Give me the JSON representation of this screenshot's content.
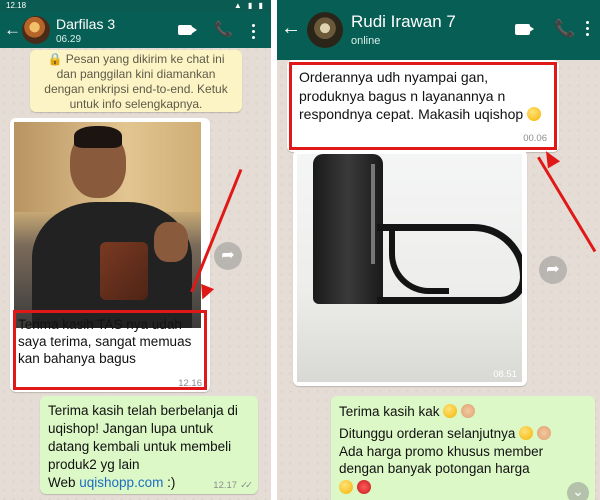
{
  "left_chat": {
    "status_time": "12.18",
    "status_icons": "▲ ▮ ▮",
    "contact_name": "Darfilas 3",
    "contact_status": "06.29",
    "system_notice": "🔒 Pesan yang dikirim ke chat ini dan panggilan kini diamankan dengan enkripsi end-to-end. Ketuk untuk info selengkapnya.",
    "incoming_text": "Terima kasih TAS nya udah saya terima, sangat memuas kan bahanya bagus",
    "incoming_time": "12.16",
    "outgoing_text": "Terima kasih telah berbelanja di uqishop! Jangan lupa untuk datang kembali untuk membeli produk2 yg lain",
    "outgoing_web_prefix": "Web ",
    "outgoing_link": "uqishopp.com",
    "outgoing_suffix": " :)",
    "outgoing_time": "12.17",
    "ticks": "✓✓"
  },
  "right_chat": {
    "contact_name": "Rudi Irawan 7",
    "contact_status": "online",
    "incoming_text": "Orderannya udh nyampai gan, produknya bagus n layanannya n respondnya cepat. Makasih uqishop",
    "incoming_time": "00.06",
    "photo_time": "08.51",
    "outgoing_line1": "Terima kasih kak",
    "outgoing_line2": "Ditunggu orderan selanjutnya",
    "outgoing_line3": "Ada harga promo khusus member dengan banyak potongan harga"
  },
  "icons": {
    "back": "←",
    "phone": "📞",
    "forward": "➦",
    "scroll_down": "⌄"
  },
  "colors": {
    "header": "#075e54",
    "outgoing_bubble": "#dcf8c6",
    "highlight": "#e01818",
    "link": "#1b6ec2"
  }
}
